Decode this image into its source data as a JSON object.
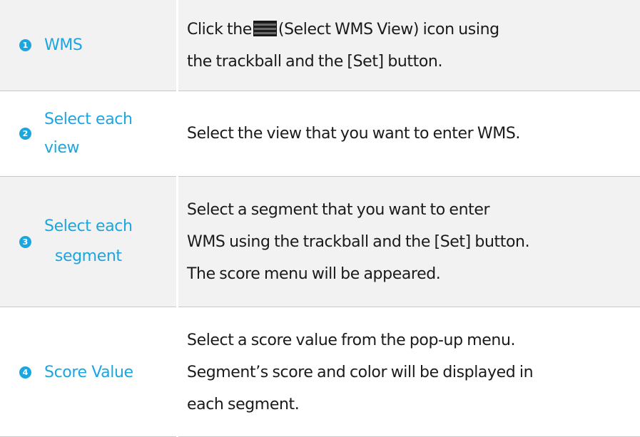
{
  "rows": [
    {
      "number": "1",
      "label_lines": [
        "WMS"
      ],
      "desc_lines": [
        "Click the",
        "(Select WMS View) icon using",
        "the trackball and the [Set] button."
      ]
    },
    {
      "number": "2",
      "label_lines": [
        "Select each",
        "view"
      ],
      "desc_lines": [
        "Select the view that you want to enter WMS."
      ]
    },
    {
      "number": "3",
      "label_lines": [
        "Select each",
        "segment"
      ],
      "desc_lines": [
        "Select a segment that you want to enter",
        "WMS using the trackball and the [Set] button.",
        "The score menu will be appeared."
      ]
    },
    {
      "number": "4",
      "label_lines": [
        "Score Value"
      ],
      "desc_lines": [
        "Select a score value from the pop-up menu.",
        "Segment’s score and color will be displayed in",
        "each segment."
      ]
    }
  ],
  "icons": {
    "inline_icon": "select-wms-view-icon"
  },
  "colors": {
    "accent": "#1ba6e0",
    "shaded_row": "#f2f2f2",
    "text": "#1a1a1a"
  }
}
